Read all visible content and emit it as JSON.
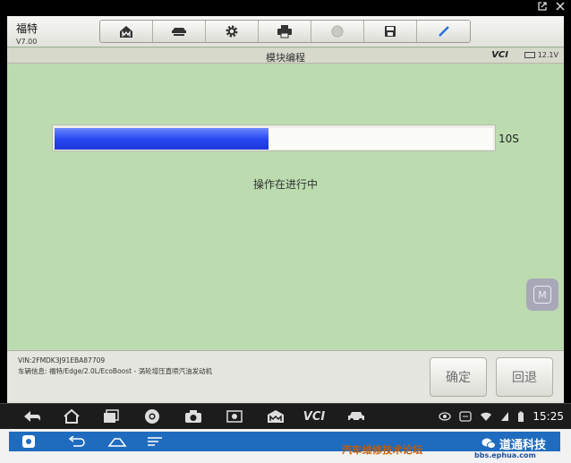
{
  "window": {
    "icons": [
      "external-link-icon",
      "close-icon"
    ]
  },
  "app": {
    "name": "福特",
    "version": "V7.00",
    "toolbar": [
      "home-icon",
      "vehicle-lift-icon",
      "settings-icon",
      "print-icon",
      "help-icon",
      "save-icon",
      "edit-icon"
    ],
    "title": "模块编程",
    "vci": "VCI",
    "battery_voltage": "12.1V"
  },
  "progress": {
    "fraction": 0.49,
    "timer": "10S",
    "status": "操作在进行中"
  },
  "footer": {
    "vin": "VIN:2FMDK3J91EBA87709",
    "vehicle_info": "车辆信息: 福特/Edge/2.0L/EcoBoost - 涡轮增压直喷汽油发动机",
    "ok_label": "确定",
    "back_label": "回退"
  },
  "navbar": {
    "clock": "15:25",
    "vci_label": "VCI"
  },
  "system": {
    "forum_text": "汽车维修技术论坛",
    "brand_text": "道通科技",
    "url": "bbs.ephua.com"
  },
  "colors": {
    "progress": "#2546f0",
    "background": "#bcdcb0",
    "sysbar": "#1f6cbf"
  }
}
